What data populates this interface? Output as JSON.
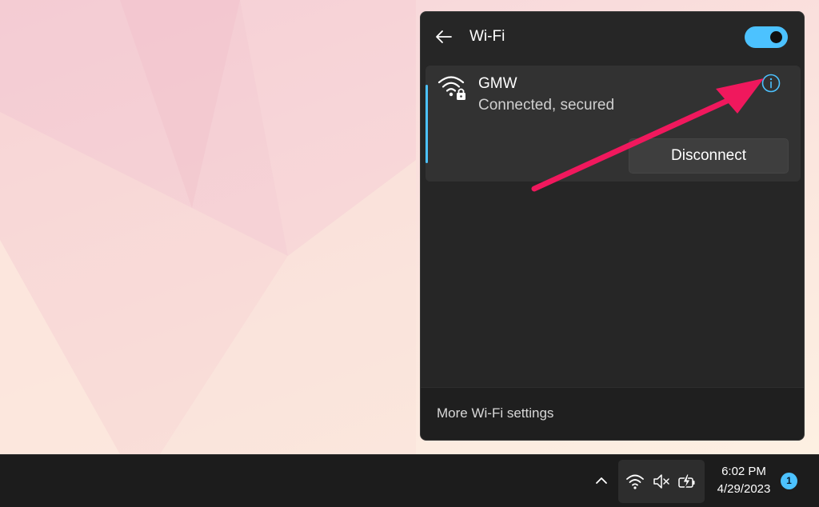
{
  "colors": {
    "accent": "#4cc2ff",
    "annotation_arrow": "#f0185d",
    "panel_bg": "#262626",
    "card_bg": "#323232",
    "taskbar_bg": "#1c1c1c"
  },
  "wifi_panel": {
    "title": "Wi-Fi",
    "back_icon": "back-arrow-icon",
    "toggle_on": true,
    "network": {
      "name": "GMW",
      "status": "Connected, secured",
      "icon": "wifi-secured-icon",
      "info_icon": "info-icon",
      "disconnect_label": "Disconnect"
    },
    "footer_link": "More Wi-Fi settings"
  },
  "taskbar": {
    "tray_icons": [
      "chevron-up-icon",
      "wifi-icon",
      "speaker-muted-icon",
      "battery-charging-icon"
    ],
    "time": "6:02 PM",
    "date": "4/29/2023",
    "notification_count": "1"
  }
}
